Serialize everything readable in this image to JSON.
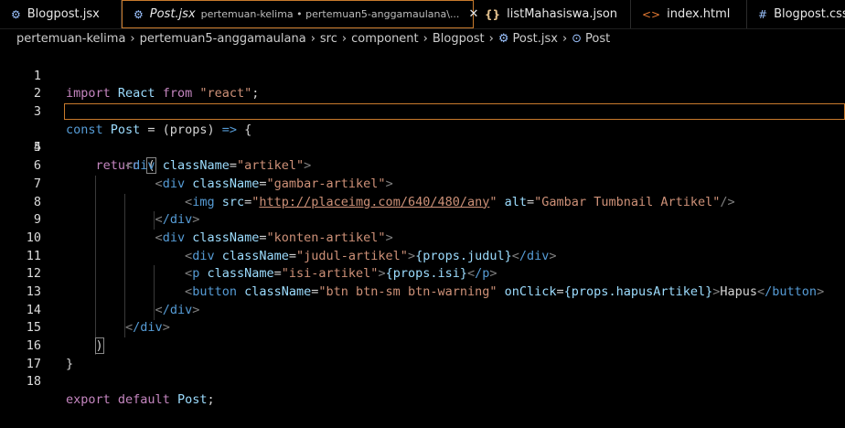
{
  "tabs": [
    {
      "icon": "gear-icon",
      "label": "Blogpost.jsx"
    },
    {
      "icon": "gear-icon",
      "label": "Post.jsx",
      "desc": "pertemuan-kelima • pertemuan5-anggamaulana\\...",
      "active": true,
      "close": "✕"
    },
    {
      "icon": "json-braces-icon",
      "label": "listMahasiswa.json"
    },
    {
      "icon": "html-icon",
      "label": "index.html"
    },
    {
      "icon": "css-hash-icon",
      "label": "Blogpost.css"
    }
  ],
  "breadcrumb": {
    "parts": [
      "pertemuan-kelima",
      "pertemuan5-anggamaulana",
      "src",
      "component",
      "Blogpost",
      "Post.jsx",
      "Post"
    ]
  },
  "lines": [
    {
      "n": "1"
    },
    {
      "n": "2"
    },
    {
      "n": "3"
    },
    {
      "n": "4"
    },
    {
      "n": "5"
    },
    {
      "n": "6"
    },
    {
      "n": "7"
    },
    {
      "n": "8"
    },
    {
      "n": "9"
    },
    {
      "n": "10"
    },
    {
      "n": "11"
    },
    {
      "n": "12"
    },
    {
      "n": "13"
    },
    {
      "n": "14"
    },
    {
      "n": "15"
    },
    {
      "n": "16"
    },
    {
      "n": "17"
    },
    {
      "n": "18"
    }
  ],
  "code": {
    "l1": {
      "kw": "import",
      "name": "React",
      "from": "from",
      "str": "\"react\"",
      "end": ";"
    },
    "l3": {
      "kw": "const",
      "name": "Post",
      "rest": " = (props) ",
      "arrow": "=>",
      "end": " {"
    },
    "l4": {
      "kw": "return",
      "end": "("
    },
    "l5": {
      "open": "<",
      "tag": "div",
      "attr": "className",
      "eq": "=",
      "val": "\"artikel\"",
      "close": ">"
    },
    "l6": {
      "tag": "div",
      "attr": "className",
      "val": "\"gambar-artikel\""
    },
    "l7": {
      "tag": "img",
      "attr1": "src",
      "val1a": "\"",
      "url": "http://placeimg.com/640/480/any",
      "val1b": "\"",
      "attr2": "alt",
      "val2": "\"Gambar Tumbnail Artikel\"",
      "end": "/>"
    },
    "l8": {
      "tag": "/div"
    },
    "l9": {
      "tag": "div",
      "attr": "className",
      "val": "\"konten-artikel\""
    },
    "l10": {
      "tag": "div",
      "attr": "className",
      "val": "\"judul-artikel\"",
      "expr": "{props.judul}",
      "etag": "/div"
    },
    "l11": {
      "tag": "p",
      "attr": "className",
      "val": "\"isi-artikel\"",
      "expr": "{props.isi}",
      "etag": "/p"
    },
    "l12": {
      "tag": "button",
      "attr": "className",
      "val": "\"btn btn-sm btn-warning\"",
      "attr2": "onClick",
      "expr": "{props.hapusArtikel}",
      "text": "Hapus",
      "etag": "/button"
    },
    "l13": {
      "tag": "/div"
    },
    "l14": {
      "tag": "/div"
    },
    "l15": {
      "paren": ")"
    },
    "l16": {
      "brace": "}"
    },
    "l18": {
      "kw1": "export",
      "kw2": "default",
      "name": "Post",
      "end": ";"
    }
  }
}
